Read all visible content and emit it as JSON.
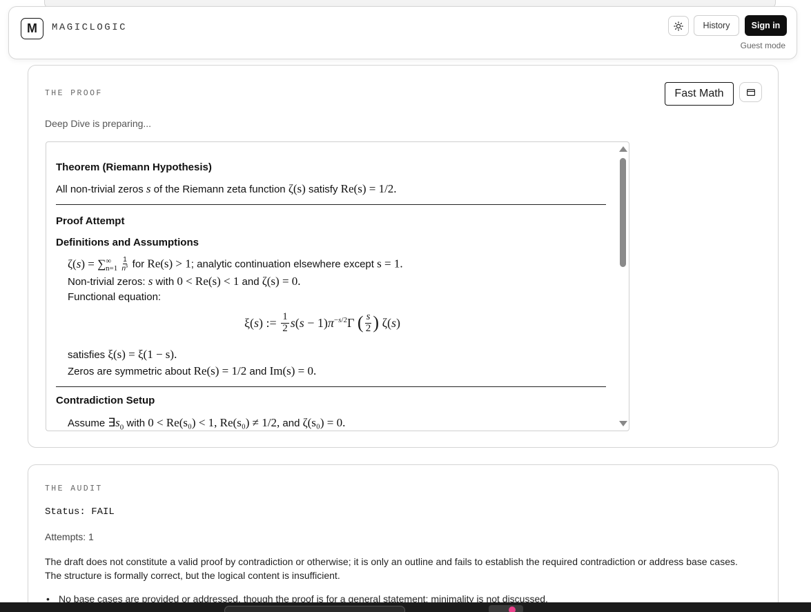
{
  "header": {
    "logo_letter": "M",
    "brand": "MAGICLOGIC",
    "theme_icon": "sun-icon",
    "history_label": "History",
    "signin_label": "Sign in",
    "mode": "Guest mode"
  },
  "proof": {
    "section_label": "THE PROOF",
    "mode_button": "Fast Math",
    "panel_icon": "window-icon",
    "status": "Deep Dive is preparing...",
    "theorem_title": "Theorem (Riemann Hypothesis)",
    "theorem_pre": "All non-trivial zeros ",
    "theorem_var": "s",
    "theorem_mid": " of the Riemann zeta function ",
    "theorem_zeta": "ζ(s)",
    "theorem_satisfy": " satisfy ",
    "theorem_cond": "Re(s) = 1/2.",
    "attempt_title": "Proof Attempt",
    "defs_title": "Definitions and Assumptions",
    "def1_for": " for ",
    "def1_cond": "Re(s) > 1",
    "def1_rest": "; analytic continuation elsewhere except ",
    "def1_end": "s = 1.",
    "def2_pre": "Non-trivial zeros: ",
    "def2_s": "s",
    "def2_with": " with ",
    "def2_cond": "0 < Re(s) < 1",
    "def2_and": " and ",
    "def2_end": "ζ(s) = 0.",
    "def3": "Functional equation:",
    "sat_pre": "satisfies ",
    "sat_eq": "ξ(s) = ξ(1 − s).",
    "sym_pre": "Zeros are symmetric about ",
    "sym_eq": "Re(s) = 1/2",
    "sym_and": " and ",
    "sym_end": "Im(s) = 0.",
    "contra_title": "Contradiction Setup",
    "contra_pre": "Assume ",
    "contra_with": " with ",
    "contra_cond": "0 < Re(s₀) < 1, Re(s₀) ≠ 1/2,",
    "contra_and": " and ",
    "contra_end": "ζ(s₀) = 0."
  },
  "audit": {
    "section_label": "THE AUDIT",
    "status": "Status: FAIL",
    "attempts": "Attempts: 1",
    "summary": "The draft does not constitute a valid proof by contradiction or otherwise; it is only an outline and fails to establish the required contradiction or address base cases. The structure is formally correct, but the logical content is insufficient.",
    "bullet1": "No base cases are provided or addressed, though the proof is for a general statement; minimality is not discussed."
  }
}
